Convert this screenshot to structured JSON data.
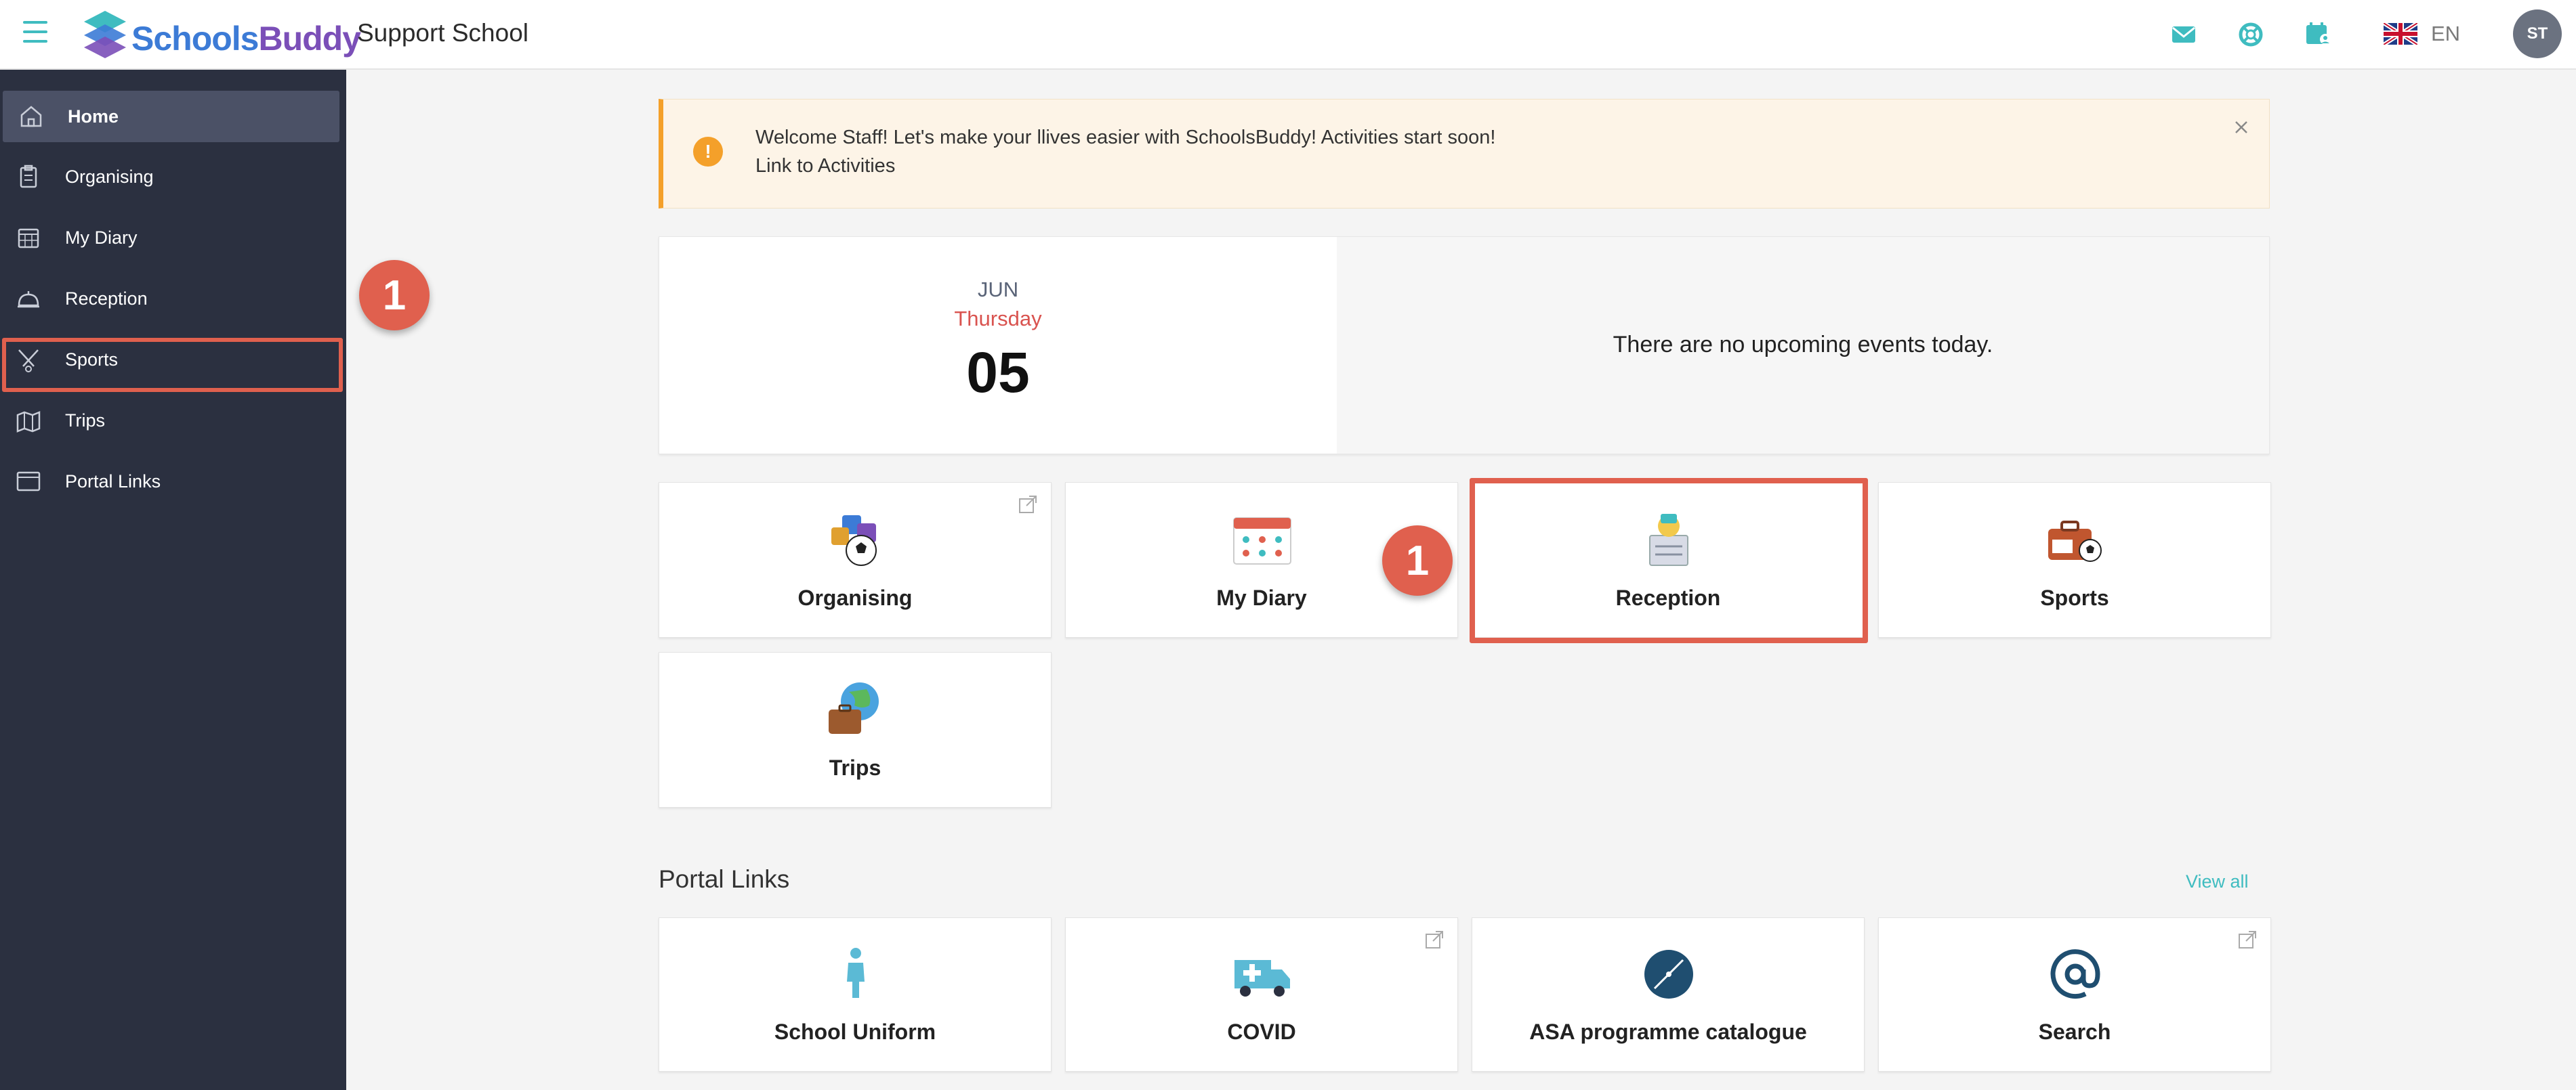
{
  "app": {
    "logo_part1": "Schools",
    "logo_part2": "Buddy",
    "school_name": "Support School",
    "language": "EN",
    "avatar_initials": "ST"
  },
  "sidebar": {
    "items": [
      {
        "label": "Home",
        "icon": "home-icon",
        "active": true
      },
      {
        "label": "Organising",
        "icon": "clipboard-icon"
      },
      {
        "label": "My Diary",
        "icon": "calendar-icon"
      },
      {
        "label": "Reception",
        "icon": "bell-icon"
      },
      {
        "label": "Sports",
        "icon": "sports-icon"
      },
      {
        "label": "Trips",
        "icon": "map-icon"
      },
      {
        "label": "Portal Links",
        "icon": "window-icon"
      }
    ]
  },
  "markers": {
    "sidebar_step": "1",
    "tile_step": "1"
  },
  "alert": {
    "line1": "Welcome Staff!  Let's make your llives easier with SchoolsBuddy!  Activities start soon!",
    "line2": "Link to Activities",
    "icon": "!"
  },
  "date_card": {
    "month": "JUN",
    "weekday": "Thursday",
    "day": "05",
    "no_events": "There are no upcoming events today."
  },
  "tiles": [
    {
      "label": "Organising"
    },
    {
      "label": "My Diary"
    },
    {
      "label": "Reception"
    },
    {
      "label": "Sports"
    },
    {
      "label": "Trips"
    }
  ],
  "portal_links": {
    "title": "Portal Links",
    "view_all": "View all",
    "items": [
      {
        "label": "School Uniform"
      },
      {
        "label": "COVID"
      },
      {
        "label": "ASA programme catalogue"
      },
      {
        "label": "Search"
      }
    ]
  },
  "colors": {
    "accent": "#3fbcc0",
    "sidebar_bg": "#2b3040",
    "highlight": "#e0604e",
    "alert_bar": "#f4a02a"
  }
}
